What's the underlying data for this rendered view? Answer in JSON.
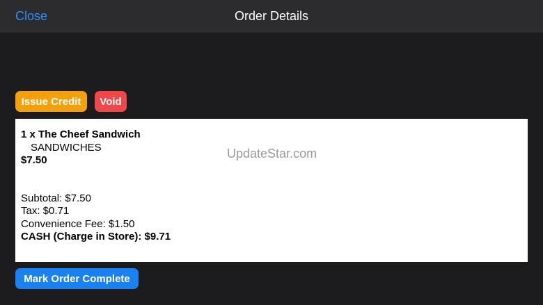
{
  "navbar": {
    "close_label": "Close",
    "title": "Order Details"
  },
  "actions": {
    "issue_credit_label": "Issue Credit",
    "void_label": "Void",
    "mark_complete_label": "Mark Order Complete"
  },
  "order": {
    "item_line": "1  x  The Cheef Sandwich",
    "item_category": "SANDWICHES",
    "item_price": "$7.50",
    "subtotal": "Subtotal: $7.50",
    "tax": "Tax: $0.71",
    "convenience_fee": "Convenience Fee: $1.50",
    "total": "CASH (Charge in Store): $9.71"
  },
  "watermark": "UpdateStar.com",
  "colors": {
    "accent_blue": "#1a82f0",
    "credit_orange": "#f4a00a",
    "void_red": "#f04848",
    "background": "#1c1c1e",
    "navbar": "#2c2c2e"
  }
}
